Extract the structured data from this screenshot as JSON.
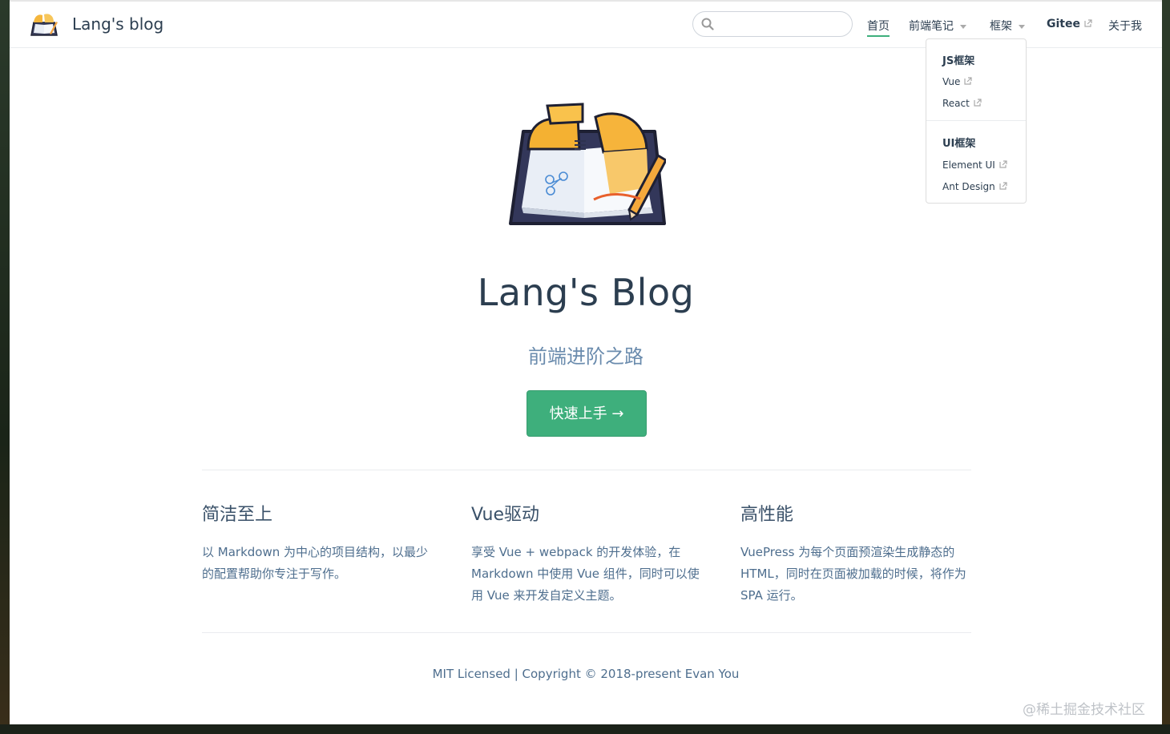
{
  "navbar": {
    "site_name": "Lang's blog",
    "search": {
      "value": "",
      "placeholder": ""
    },
    "items": [
      {
        "label": "首页",
        "active": true
      },
      {
        "label": "前端笔记",
        "has_dropdown": true
      },
      {
        "label": "框架",
        "has_dropdown": true
      },
      {
        "label": "Gitee",
        "external": true
      },
      {
        "label": "关于我"
      }
    ]
  },
  "dropdown": {
    "groups": [
      {
        "title": "JS框架",
        "items": [
          "Vue",
          "React"
        ]
      },
      {
        "title": "UI框架",
        "items": [
          "Element UI",
          "Ant Design"
        ]
      }
    ]
  },
  "hero": {
    "title": "Lang's Blog",
    "description": "前端进阶之路",
    "action_label": "快速上手 →"
  },
  "features": [
    {
      "title": "简洁至上",
      "details": "以 Markdown 为中心的项目结构，以最少的配置帮助你专注于写作。"
    },
    {
      "title": "Vue驱动",
      "details": "享受 Vue + webpack 的开发体验，在 Markdown 中使用 Vue 组件，同时可以使用 Vue 来开发自定义主题。"
    },
    {
      "title": "高性能",
      "details": "VuePress 为每个页面预渲染生成静态的 HTML，同时在页面被加载的时候，将作为 SPA 运行。"
    }
  ],
  "footer": {
    "text": "MIT Licensed | Copyright © 2018-present Evan You"
  },
  "watermark": {
    "text": "@稀土掘金技术社区"
  },
  "colors": {
    "accent": "#3eaf7c",
    "text": "#2c3e50",
    "muted": "#6a8bad"
  },
  "icons": {
    "search": "search-icon",
    "external": "external-link-icon",
    "caret": "chevron-down-icon"
  }
}
